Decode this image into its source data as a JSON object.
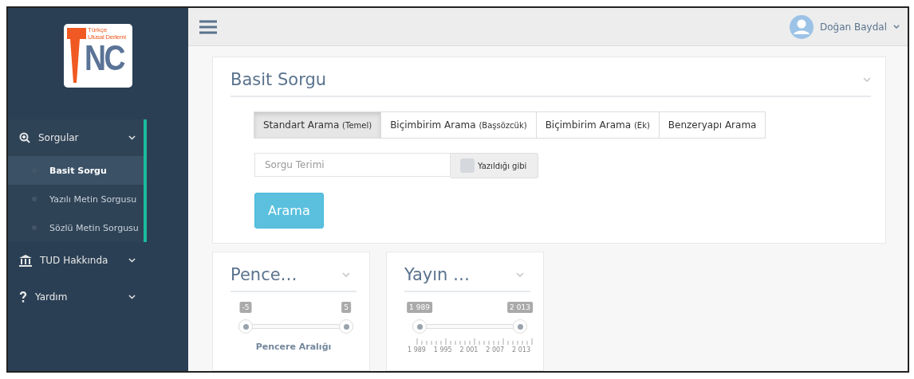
{
  "sidebar": {
    "logo": {
      "line_1": "Türkçe",
      "line_2": "Ulusal Derlemi",
      "letters": "NC"
    },
    "items": [
      {
        "label": "Sorgular",
        "expanded": true,
        "children": [
          {
            "label": "Basit Sorgu",
            "selected": true
          },
          {
            "label": "Yazılı Metin Sorgusu",
            "selected": false
          },
          {
            "label": "Sözlü Metin Sorgusu",
            "selected": false
          }
        ]
      },
      {
        "label": "TUD Hakkında",
        "expanded": false
      },
      {
        "label": "Yardım",
        "expanded": false
      }
    ]
  },
  "topbar": {
    "user": "Doğan Baydal"
  },
  "query_panel": {
    "title": "Basit Sorgu",
    "tabs": [
      {
        "label": "Standart Arama",
        "note": "(Temel)",
        "selected": true
      },
      {
        "label": "Biçimbirim Arama",
        "note": "(Başsözcük)",
        "selected": false
      },
      {
        "label": "Biçimbirim Arama",
        "note": "(Ek)",
        "selected": false
      },
      {
        "label": "Benzeryapı Arama",
        "selected": false
      }
    ],
    "search": {
      "placeholder": "Sorgu Terimi"
    },
    "exact": {
      "label": "Yazıldığı gibi",
      "checked": false
    },
    "button": "Arama"
  },
  "filters": [
    {
      "title": "Pence…",
      "thumbs": [
        {
          "label": "-5",
          "level": 0
        },
        {
          "label": "5",
          "level": 1
        }
      ],
      "caption": "Pencere Aralığı"
    },
    {
      "title": "Yayın …",
      "thumbs": [
        {
          "label": "1 989",
          "level": 0
        },
        {
          "label": "2 013",
          "level": 1
        }
      ],
      "scale": [
        "1 989",
        "1 995",
        "2 001",
        "2 007",
        "2 013"
      ]
    }
  ]
}
